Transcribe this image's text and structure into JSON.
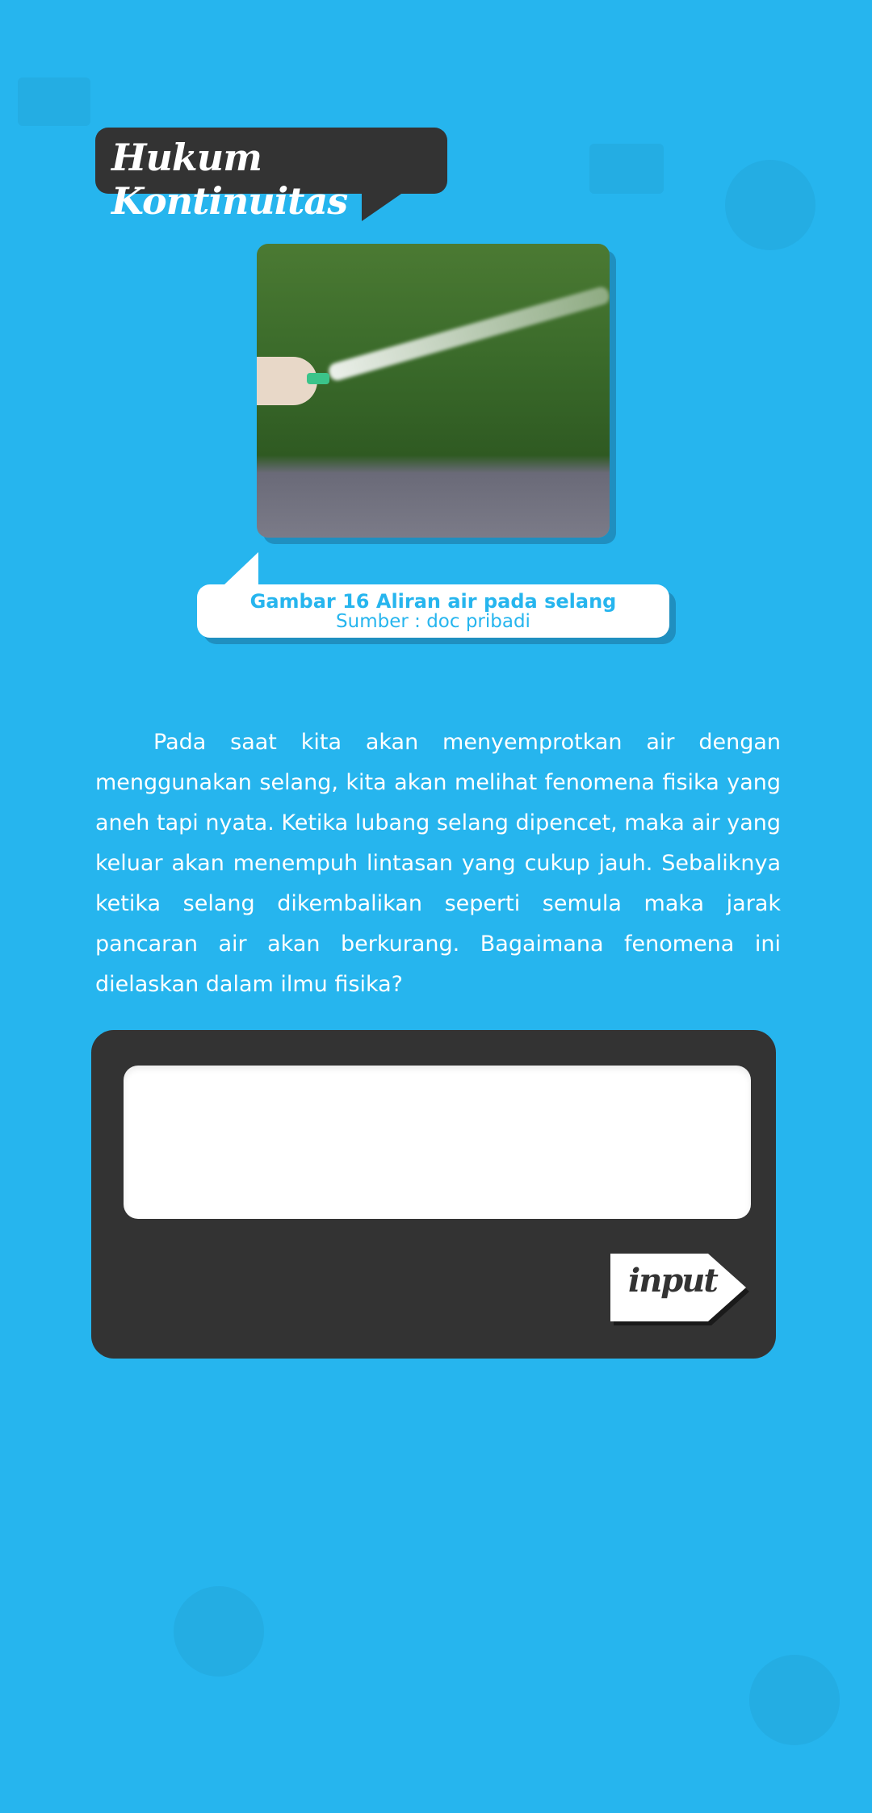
{
  "header": {
    "title": "Hukum Kontinuitas"
  },
  "figure": {
    "caption": "Gambar 16 Aliran air pada selang",
    "source": "Sumber : doc pribadi"
  },
  "body": {
    "paragraph": "Pada saat kita akan menyemprotkan air dengan menggunakan selang, kita akan melihat fenomena fisika yang aneh tapi nyata. Ketika lubang selang dipencet, maka air yang keluar akan menempuh lintasan yang cukup jauh. Sebaliknya ketika selang dikembalikan seperti semula maka jarak pancaran air akan berkurang. Bagaimana fenomena ini dielaskan dalam ilmu fisika?"
  },
  "answer": {
    "value": "",
    "button_label": "input"
  },
  "colors": {
    "background": "#26b5ee",
    "dark": "#333333",
    "accent": "#26b5ee"
  }
}
